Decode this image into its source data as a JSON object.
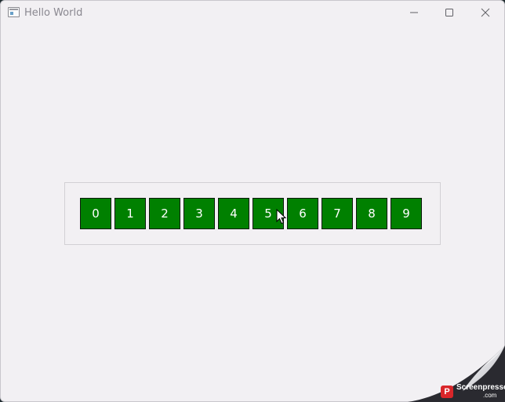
{
  "window": {
    "title": "Hello World"
  },
  "caption_buttons": {
    "minimize_icon": "minimize-icon",
    "maximize_icon": "maximize-icon",
    "close_icon": "close-icon"
  },
  "buttons": [
    "0",
    "1",
    "2",
    "3",
    "4",
    "5",
    "6",
    "7",
    "8",
    "9"
  ],
  "colors": {
    "button_fill": "#008000",
    "window_bg": "#f2f0f3"
  },
  "watermark": {
    "brand": "Screenpresso",
    "suffix": ".com"
  }
}
